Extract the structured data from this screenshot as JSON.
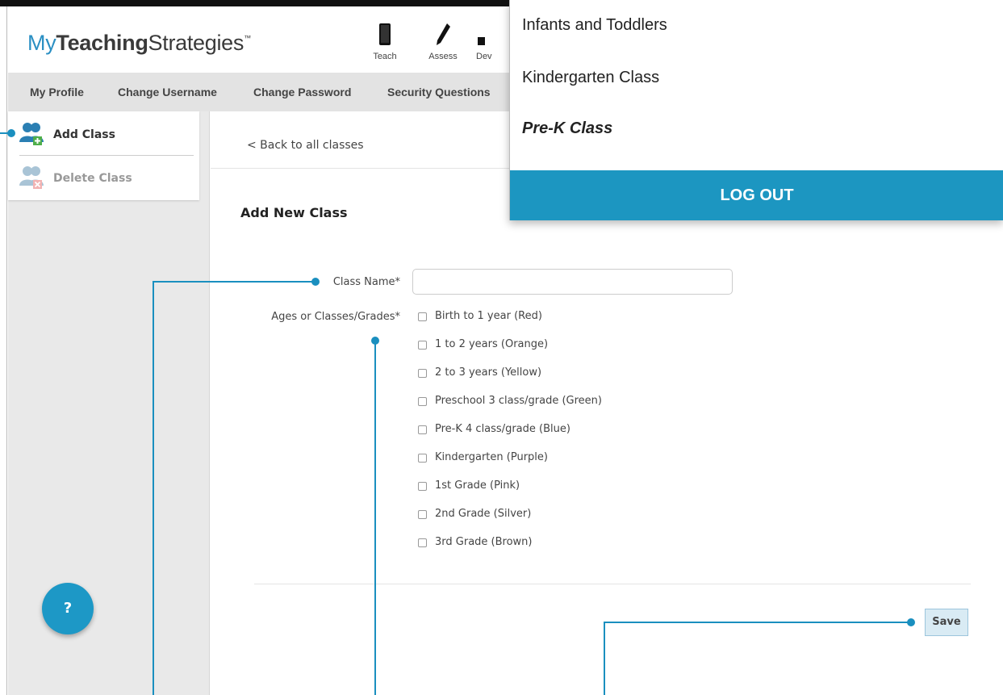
{
  "header": {
    "logo": {
      "my": "My",
      "teaching": "Teaching",
      "strategies": "Strategies",
      "tm": "™"
    },
    "nav": [
      {
        "label": "Teach",
        "icon": "book-icon"
      },
      {
        "label": "Assess",
        "icon": "pencil-icon"
      },
      {
        "label": "Dev",
        "icon": "chart-icon"
      }
    ]
  },
  "subnav": {
    "items": [
      "My Profile",
      "Change Username",
      "Change Password",
      "Security Questions"
    ]
  },
  "sidebar": {
    "items": [
      {
        "label": "Add Class",
        "icon": "add-users-icon"
      },
      {
        "label": "Delete Class",
        "icon": "delete-users-icon"
      }
    ],
    "help_label": "?"
  },
  "main": {
    "back_link": "< Back to all classes",
    "form_title": "Add New Class",
    "class_name_label": "Class Name*",
    "class_name_value": "",
    "ages_label": "Ages or Classes/Grades*",
    "options": [
      "Birth to 1 year (Red)",
      "1 to 2 years (Orange)",
      "2 to 3 years (Yellow)",
      "Preschool 3 class/grade (Green)",
      "Pre-K 4 class/grade (Blue)",
      "Kindergarten (Purple)",
      "1st Grade (Pink)",
      "2nd Grade (Silver)",
      "3rd Grade (Brown)"
    ],
    "save_label": "Save"
  },
  "dropdown": {
    "items": [
      "Infants and Toddlers",
      "Kindergarten Class",
      "Pre-K Class"
    ],
    "current": "Pre-K Class",
    "logout_label": "LOG OUT"
  },
  "colors": {
    "accent": "#1c96c1",
    "callout": "#1a8fbf"
  }
}
